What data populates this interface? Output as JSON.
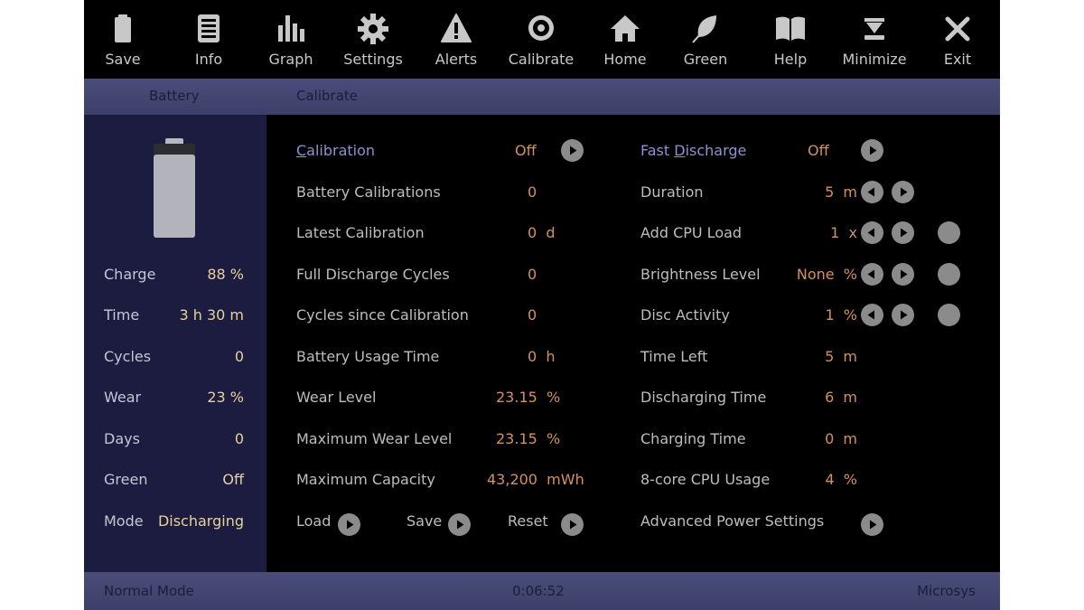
{
  "toolbar": {
    "items": [
      {
        "label": "Save",
        "icon": "battery-icon"
      },
      {
        "label": "Info",
        "icon": "list-icon"
      },
      {
        "label": "Graph",
        "icon": "bar-chart-icon"
      },
      {
        "label": "Settings",
        "icon": "gear-icon"
      },
      {
        "label": "Alerts",
        "icon": "warning-icon"
      },
      {
        "label": "Calibrate",
        "icon": "target-icon"
      },
      {
        "label": "Home",
        "icon": "home-icon"
      },
      {
        "label": "Green",
        "icon": "leaf-icon"
      },
      {
        "label": "Help",
        "icon": "book-icon"
      },
      {
        "label": "Minimize",
        "icon": "minimize-icon"
      },
      {
        "label": "Exit",
        "icon": "close-icon"
      }
    ]
  },
  "tabs": {
    "battery": "Battery",
    "calibrate": "Calibrate"
  },
  "sidebar": {
    "charge_level": 0.88,
    "stats": [
      {
        "label": "Charge",
        "value": "88 %"
      },
      {
        "label": "Time",
        "value": "3 h 30 m"
      },
      {
        "label": "Cycles",
        "value": "0"
      },
      {
        "label": "Wear",
        "value": "23 %"
      },
      {
        "label": "Days",
        "value": "0"
      },
      {
        "label": "Green",
        "value": "Off"
      },
      {
        "label": "Mode",
        "value": "Discharging"
      }
    ]
  },
  "calibration": {
    "title_first": "C",
    "title_rest": "alibration",
    "state": "Off",
    "rows": [
      {
        "label": "Battery Calibrations",
        "value": "0"
      },
      {
        "label": "Latest Calibration",
        "value": "0  d"
      },
      {
        "label": "Full Discharge Cycles",
        "value": "0"
      },
      {
        "label": "Cycles since Calibration",
        "value": "0"
      },
      {
        "label": "Battery Usage Time",
        "value": "0  h"
      },
      {
        "label": "Wear Level",
        "value": "23.15  %"
      },
      {
        "label": "Maximum Wear Level",
        "value": "23.15  %"
      },
      {
        "label": "Maximum Capacity",
        "value": "43,200  mWh"
      }
    ],
    "actions": {
      "load": "Load",
      "save": "Save",
      "reset": "Reset"
    }
  },
  "fast_discharge": {
    "title_pre": "Fast ",
    "title_ul": "D",
    "title_post": "ischarge",
    "state": "Off",
    "rows": [
      {
        "label": "Duration",
        "value": "5  m"
      },
      {
        "label": "Add CPU Load",
        "value": "1  x"
      },
      {
        "label": "Brightness Level",
        "value": "None  %"
      },
      {
        "label": "Disc Activity",
        "value": "1  %"
      },
      {
        "label": "Time Left",
        "value": "5  m"
      },
      {
        "label": "Discharging Time",
        "value": "6  m"
      },
      {
        "label": "Charging Time",
        "value": "0  m"
      },
      {
        "label": "8-core CPU Usage",
        "value": "4  %"
      }
    ],
    "advanced": "Advanced Power Settings"
  },
  "status": {
    "mode": "Normal Mode",
    "timer": "0:06:52",
    "brand": "Microsys"
  },
  "colors": {
    "label": "#bdbdbd",
    "value_orange": "#d4915f",
    "value_yellow": "#e6d29a",
    "link": "#8f90d6",
    "bar": "#44476f",
    "sidebar": "#1b1c3f"
  }
}
